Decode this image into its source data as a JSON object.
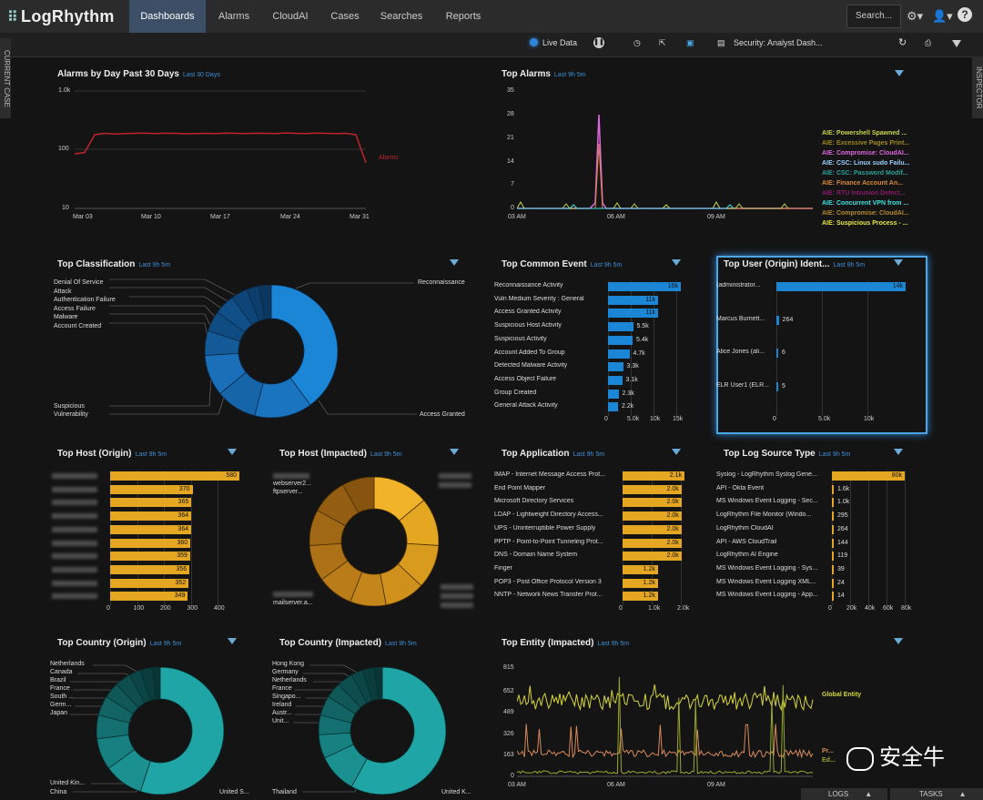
{
  "app": {
    "logo": "LogRhythm",
    "nav": [
      "Dashboards",
      "Alarms",
      "CloudAI",
      "Cases",
      "Searches",
      "Reports"
    ],
    "search_label": "Search..."
  },
  "subbar": {
    "live_data": "Live Data",
    "layout_name": "Security: Analyst Dash..."
  },
  "side": {
    "left": "CURRENT CASE",
    "right": "INSPECTOR"
  },
  "alarms_by_day": {
    "title": "Alarms by Day Past 30 Days",
    "subtitle": "Last 30 Days",
    "y_ticks": [
      "1.0k",
      "100",
      "10"
    ],
    "x_ticks": [
      "Mar 03",
      "Mar 10",
      "Mar 17",
      "Mar 24",
      "Mar 31"
    ],
    "legend": "Alarms",
    "chart_data": {
      "type": "line",
      "scale": "log",
      "ylim": [
        10,
        1000
      ],
      "values": [
        85,
        90,
        180,
        190,
        185,
        188,
        190,
        192,
        188,
        191,
        190,
        187,
        189,
        190,
        188,
        192,
        190,
        189,
        191,
        190,
        188,
        193,
        190,
        189,
        192,
        190,
        188,
        190,
        180,
        60
      ]
    }
  },
  "top_alarms": {
    "title": "Top Alarms",
    "subtitle": "Last 9h 5m",
    "y_ticks": [
      "35",
      "28",
      "21",
      "14",
      "7",
      "0"
    ],
    "x_ticks": [
      "03 AM",
      "06 AM",
      "09 AM"
    ],
    "legend": [
      {
        "label": "AIE: Powershell Spawned ...",
        "color": "#c9d64a"
      },
      {
        "label": "AIE: Excessive Pages Print...",
        "color": "#a08a1e"
      },
      {
        "label": "AIE: Compromise: CloudAI...",
        "color": "#e066e0"
      },
      {
        "label": "AIE: CSC: Linux sudo Failu...",
        "color": "#9ad0ff"
      },
      {
        "label": "AIE: CSC: Password Modif...",
        "color": "#2aa198"
      },
      {
        "label": "AIE: Finance Account An...",
        "color": "#d88a3a"
      },
      {
        "label": "AIE: RTU Intrusion Detect...",
        "color": "#8a1a6a"
      },
      {
        "label": "AIE: Concurrent VPN from ...",
        "color": "#3fe0e0"
      },
      {
        "label": "AIE: Compromise: CloudAI...",
        "color": "#b58a2e"
      },
      {
        "label": "AIE: Suspicious Process - ...",
        "color": "#e8e84a"
      }
    ],
    "chart_data": {
      "type": "line",
      "ylim": [
        0,
        35
      ],
      "peak_value": 27,
      "peak_color": "#e066e0"
    }
  },
  "top_classification": {
    "title": "Top Classification",
    "subtitle": "Last 9h 5m",
    "labels_left_top": [
      "Denial Of Service",
      "Attack",
      "Authentication Failure",
      "Access Failure",
      "Malware",
      "Account Created"
    ],
    "labels_left_bottom": [
      "Suspicious",
      "Vulnerability"
    ],
    "label_right_top": "Reconnaissance",
    "label_right_bottom": "Access Granted",
    "chart_data": {
      "type": "pie",
      "slices": [
        {
          "name": "Reconnaissance",
          "value": 40,
          "color": "#1c86d6"
        },
        {
          "name": "Access Granted",
          "value": 14,
          "color": "#1a74c0"
        },
        {
          "name": "Vulnerability",
          "value": 10,
          "color": "#1765a9"
        },
        {
          "name": "Suspicious",
          "value": 10,
          "color": "#1a6fb8"
        },
        {
          "name": "Account Created",
          "value": 6,
          "color": "#145a98"
        },
        {
          "name": "Malware",
          "value": 5,
          "color": "#0f4c82"
        },
        {
          "name": "Access Failure",
          "value": 5,
          "color": "#114f88"
        },
        {
          "name": "Authentication Failure",
          "value": 4,
          "color": "#0e4578"
        },
        {
          "name": "Attack",
          "value": 3,
          "color": "#0c3d6c"
        },
        {
          "name": "Denial Of Service",
          "value": 3,
          "color": "#0b3660"
        }
      ]
    }
  },
  "top_common_event": {
    "title": "Top Common Event",
    "subtitle": "Last 9h 5m",
    "max": 15000,
    "x_ticks": [
      "0",
      "5.0k",
      "10k",
      "15k"
    ],
    "chart_data": {
      "type": "bar",
      "orientation": "horizontal",
      "items": [
        {
          "name": "Reconnaissance Activity",
          "value": 16000,
          "label": "16k"
        },
        {
          "name": "Vuln Medium Severity : General",
          "value": 11000,
          "label": "11k"
        },
        {
          "name": "Access Granted Activity",
          "value": 11000,
          "label": "11k"
        },
        {
          "name": "Suspicious Host Activity",
          "value": 5500,
          "label": "5.5k"
        },
        {
          "name": "Suspicious Activity",
          "value": 5400,
          "label": "5.4k"
        },
        {
          "name": "Account Added To Group",
          "value": 4700,
          "label": "4.7k"
        },
        {
          "name": "Detected Malware Activity",
          "value": 3300,
          "label": "3.3k"
        },
        {
          "name": "Access Object Failure",
          "value": 3100,
          "label": "3.1k"
        },
        {
          "name": "Group Created",
          "value": 2300,
          "label": "2.3k"
        },
        {
          "name": "General Attack Activity",
          "value": 2200,
          "label": "2.2k"
        }
      ]
    }
  },
  "top_user_origin": {
    "title": "Top User (Origin) Ident...",
    "subtitle": "Last 9h 5m",
    "x_ticks": [
      "0",
      "5.0k",
      "10k"
    ],
    "chart_data": {
      "type": "bar",
      "orientation": "horizontal",
      "items": [
        {
          "name": "{administrator...",
          "value": 14000,
          "label": "14k"
        },
        {
          "name": "Marcus Burnett...",
          "value": 264,
          "label": "264"
        },
        {
          "name": "Alice Jones (ali...",
          "value": 6,
          "label": "6"
        },
        {
          "name": "ELR User1 (ELR...",
          "value": 5,
          "label": "5"
        }
      ]
    }
  },
  "top_host_origin": {
    "title": "Top Host (Origin)",
    "subtitle": "Last 9h 5m",
    "x_ticks": [
      "0",
      "100",
      "200",
      "300",
      "400"
    ],
    "chart_data": {
      "type": "bar",
      "orientation": "horizontal",
      "items": [
        {
          "value": 580,
          "label": "580"
        },
        {
          "value": 370,
          "label": "370"
        },
        {
          "value": 365,
          "label": "365"
        },
        {
          "value": 364,
          "label": "364"
        },
        {
          "value": 364,
          "label": "364"
        },
        {
          "value": 360,
          "label": "360"
        },
        {
          "value": 359,
          "label": "359"
        },
        {
          "value": 356,
          "label": "356"
        },
        {
          "value": 352,
          "label": "352"
        },
        {
          "value": 349,
          "label": "349"
        }
      ]
    }
  },
  "top_host_impacted": {
    "title": "Top Host (Impacted)",
    "subtitle": "Last 9h 5m",
    "labels": [
      "webserver2...",
      "ftpserver...",
      "mailserver.a..."
    ],
    "chart_data": {
      "type": "pie",
      "slices": [
        {
          "value": 14,
          "color": "#f0b32a"
        },
        {
          "value": 12,
          "color": "#e5a722"
        },
        {
          "value": 11,
          "color": "#d99b1e"
        },
        {
          "value": 10,
          "color": "#cf911c"
        },
        {
          "value": 9,
          "color": "#c4861a"
        },
        {
          "value": 9,
          "color": "#b97c18"
        },
        {
          "value": 9,
          "color": "#ad7216"
        },
        {
          "value": 9,
          "color": "#a06814"
        },
        {
          "value": 9,
          "color": "#945e12"
        },
        {
          "value": 8,
          "color": "#875410"
        }
      ]
    }
  },
  "top_application": {
    "title": "Top Application",
    "subtitle": "Last 9h 5m",
    "x_ticks": [
      "0",
      "1.0k",
      "2.0k"
    ],
    "chart_data": {
      "type": "bar",
      "orientation": "horizontal",
      "items": [
        {
          "name": "IMAP - Internet Message Access Prot...",
          "value": 2100,
          "label": "2.1k"
        },
        {
          "name": "End Point Mapper",
          "value": 2000,
          "label": "2.0k"
        },
        {
          "name": "Microsoft Directory Services",
          "value": 2000,
          "label": "2.0k"
        },
        {
          "name": "LDAP - Lightweight Directory Access...",
          "value": 2000,
          "label": "2.0k"
        },
        {
          "name": "UPS - Uninterruptible Power Supply",
          "value": 2000,
          "label": "2.0k"
        },
        {
          "name": "PPTP - Point-to-Point Tunneling Prot...",
          "value": 2000,
          "label": "2.0k"
        },
        {
          "name": "DNS - Domain Name System",
          "value": 2000,
          "label": "2.0k"
        },
        {
          "name": "Finger",
          "value": 1200,
          "label": "1.2k"
        },
        {
          "name": "POP3 - Post Office Protocol Version 3",
          "value": 1200,
          "label": "1.2k"
        },
        {
          "name": "NNTP - Network News Transfer Prot...",
          "value": 1200,
          "label": "1.2k"
        }
      ]
    }
  },
  "top_log_source_type": {
    "title": "Top Log Source Type",
    "subtitle": "Last 9h 5m",
    "x_ticks": [
      "0",
      "20k",
      "40k",
      "60k",
      "80k"
    ],
    "chart_data": {
      "type": "bar",
      "orientation": "horizontal",
      "items": [
        {
          "name": "Syslog - LogRhythm Syslog Gene...",
          "value": 80000,
          "label": "80k"
        },
        {
          "name": "API - Okta Event",
          "value": 1600,
          "label": "1.6k"
        },
        {
          "name": "MS Windows Event Logging - Sec...",
          "value": 1000,
          "label": "1.0k"
        },
        {
          "name": "LogRhythm File Monitor (Windo...",
          "value": 295,
          "label": "295"
        },
        {
          "name": "LogRhythm CloudAI",
          "value": 264,
          "label": "264"
        },
        {
          "name": "API - AWS CloudTrail",
          "value": 144,
          "label": "144"
        },
        {
          "name": "LogRhythm AI Engine",
          "value": 119,
          "label": "119"
        },
        {
          "name": "MS Windows Event Logging - Sys...",
          "value": 39,
          "label": "39"
        },
        {
          "name": "MS Windows Event Logging XML...",
          "value": 24,
          "label": "24"
        },
        {
          "name": "MS Windows Event Logging - App...",
          "value": 14,
          "label": "14"
        }
      ]
    }
  },
  "top_country_origin": {
    "title": "Top Country (Origin)",
    "subtitle": "Last 9h 5m",
    "labels_left_top": [
      "Netherlands",
      "Canada",
      "Brazil",
      "France",
      "South ...",
      "Germ...",
      "Japan"
    ],
    "labels_left_bottom": [
      "United Kin...",
      "China"
    ],
    "label_right_bottom": "United S...",
    "chart_data": {
      "type": "pie",
      "slices": [
        {
          "name": "United S...",
          "value": 55,
          "color": "#1fa5a5"
        },
        {
          "name": "China",
          "value": 10,
          "color": "#1a9090"
        },
        {
          "name": "United Kin...",
          "value": 8,
          "color": "#178080"
        },
        {
          "name": "Japan",
          "value": 6,
          "color": "#147070"
        },
        {
          "name": "Germ...",
          "value": 5,
          "color": "#126464"
        },
        {
          "name": "South ...",
          "value": 4,
          "color": "#105858"
        },
        {
          "name": "France",
          "value": 4,
          "color": "#0e4e4e"
        },
        {
          "name": "Brazil",
          "value": 3,
          "color": "#0c4545"
        },
        {
          "name": "Canada",
          "value": 3,
          "color": "#0b3d3d"
        },
        {
          "name": "Netherlands",
          "value": 2,
          "color": "#093535"
        }
      ]
    }
  },
  "top_country_impacted": {
    "title": "Top Country (Impacted)",
    "subtitle": "Last 9h 5m",
    "labels_left_top": [
      "Hong Kong",
      "Germany",
      "Netherlands",
      "France",
      "Singapo...",
      "Ireland",
      "Austr...",
      "Unit..."
    ],
    "label_left_bottom": "Thailand",
    "label_right_bottom": "United K...",
    "chart_data": {
      "type": "pie",
      "slices": [
        {
          "name": "United K...",
          "value": 58,
          "color": "#1fa5a5"
        },
        {
          "name": "Thailand",
          "value": 10,
          "color": "#1a9090"
        },
        {
          "name": "Unit...",
          "value": 6,
          "color": "#178080"
        },
        {
          "name": "Austr...",
          "value": 5,
          "color": "#147070"
        },
        {
          "name": "Ireland",
          "value": 5,
          "color": "#126464"
        },
        {
          "name": "Singapo...",
          "value": 4,
          "color": "#105858"
        },
        {
          "name": "France",
          "value": 4,
          "color": "#0e4e4e"
        },
        {
          "name": "Netherlands",
          "value": 3,
          "color": "#0c4545"
        },
        {
          "name": "Germany",
          "value": 3,
          "color": "#0b3d3d"
        },
        {
          "name": "Hong Kong",
          "value": 2,
          "color": "#093535"
        }
      ]
    }
  },
  "top_entity_impacted": {
    "title": "Top Entity (Impacted)",
    "subtitle": "Last 9h 5m",
    "y_ticks": [
      "815",
      "652",
      "489",
      "326",
      "163",
      "0"
    ],
    "x_ticks": [
      "03 AM",
      "06 AM",
      "09 AM"
    ],
    "legend": [
      {
        "label": "Global Entity",
        "color": "#d6d63a"
      },
      {
        "label": "Pr...",
        "color": "#d88a5a"
      },
      {
        "label": "Ed...",
        "color": "#9aa82a"
      }
    ],
    "chart_data": {
      "type": "line",
      "ylim": [
        0,
        815
      ]
    }
  },
  "bottom": {
    "logs": "LOGS",
    "tasks": "TASKS"
  },
  "watermark": "安全牛"
}
